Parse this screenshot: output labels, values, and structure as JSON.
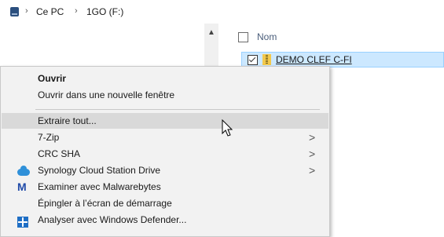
{
  "breadcrumb": {
    "items": [
      "Ce PC",
      "1GO (F:)"
    ],
    "separator": "›"
  },
  "file_list": {
    "column_name": "Nom",
    "rows": [
      {
        "name": "DEMO CLEF C-FI",
        "selected": true,
        "checked": true
      }
    ]
  },
  "context_menu": {
    "items": [
      {
        "label": "Ouvrir",
        "bold": true
      },
      {
        "label": "Ouvrir dans une nouvelle fenêtre"
      },
      {
        "label": "Extraire tout...",
        "hover": true
      },
      {
        "label": "7-Zip",
        "submenu": true
      },
      {
        "label": "CRC SHA",
        "submenu": true
      },
      {
        "label": "Synology Cloud Station Drive",
        "submenu": true,
        "icon": "cloud-icon"
      },
      {
        "label": "Examiner avec Malwarebytes",
        "icon": "malwarebytes-icon"
      },
      {
        "label": "Épingler à l’écran de démarrage"
      },
      {
        "label": "Analyser avec Windows Defender...",
        "icon": "defender-icon"
      }
    ],
    "submenu_arrow": ">"
  },
  "colors": {
    "selection_bg": "#cce8ff",
    "menu_bg": "#f2f2f2",
    "menu_hover": "#d9d9d9"
  }
}
